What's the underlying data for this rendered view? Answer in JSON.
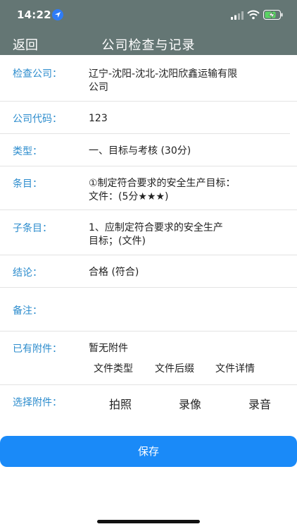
{
  "status_bar": {
    "time": "14:22",
    "icons": [
      "location-arrow-icon",
      "signal-icon",
      "wifi-icon",
      "battery-charging-icon"
    ]
  },
  "nav": {
    "back_label": "返回",
    "title": "公司检查与记录"
  },
  "rows": [
    {
      "label": "检查公司：",
      "value_line1": "辽宁-沈阳-沈北-沈阳欣鑫运输有限",
      "value_line2": "公司"
    },
    {
      "label": "公司代码：",
      "value": "123"
    },
    {
      "label": "类型：",
      "value": "一、目标与考核 (30分)"
    },
    {
      "label": "条目：",
      "value_line1": "①制定符合要求的安全生产目标：",
      "value_line2": "文件：(5分★★★)"
    },
    {
      "label": "子条目：",
      "value_line1": "1、应制定符合要求的安全生产",
      "value_line2": "目标；(文件)"
    },
    {
      "label": "结论：",
      "value": "合格 (符合)"
    },
    {
      "label": "备注：",
      "value": ""
    }
  ],
  "attachments": {
    "label": "已有附件：",
    "empty_text": "暂无附件",
    "columns": [
      "文件类型",
      "文件后缀",
      "文件详情"
    ]
  },
  "select_attachment": {
    "label": "选择附件：",
    "options": [
      "拍照",
      "录像",
      "录音"
    ]
  },
  "save_label": "保存",
  "colors": {
    "header_bg": "#647674",
    "label_color": "#2c8ccd",
    "save_button_bg": "#1a8af8"
  }
}
